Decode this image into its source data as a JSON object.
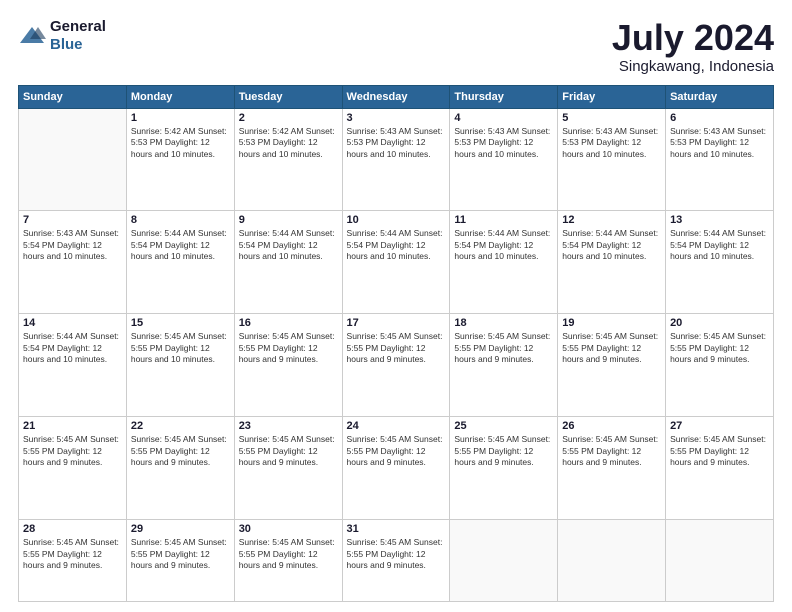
{
  "header": {
    "logo_general": "General",
    "logo_blue": "Blue",
    "title": "July 2024",
    "location": "Singkawang, Indonesia"
  },
  "days_of_week": [
    "Sunday",
    "Monday",
    "Tuesday",
    "Wednesday",
    "Thursday",
    "Friday",
    "Saturday"
  ],
  "weeks": [
    [
      {
        "num": "",
        "info": ""
      },
      {
        "num": "1",
        "info": "Sunrise: 5:42 AM\nSunset: 5:53 PM\nDaylight: 12 hours\nand 10 minutes."
      },
      {
        "num": "2",
        "info": "Sunrise: 5:42 AM\nSunset: 5:53 PM\nDaylight: 12 hours\nand 10 minutes."
      },
      {
        "num": "3",
        "info": "Sunrise: 5:43 AM\nSunset: 5:53 PM\nDaylight: 12 hours\nand 10 minutes."
      },
      {
        "num": "4",
        "info": "Sunrise: 5:43 AM\nSunset: 5:53 PM\nDaylight: 12 hours\nand 10 minutes."
      },
      {
        "num": "5",
        "info": "Sunrise: 5:43 AM\nSunset: 5:53 PM\nDaylight: 12 hours\nand 10 minutes."
      },
      {
        "num": "6",
        "info": "Sunrise: 5:43 AM\nSunset: 5:53 PM\nDaylight: 12 hours\nand 10 minutes."
      }
    ],
    [
      {
        "num": "7",
        "info": "Sunrise: 5:43 AM\nSunset: 5:54 PM\nDaylight: 12 hours\nand 10 minutes."
      },
      {
        "num": "8",
        "info": "Sunrise: 5:44 AM\nSunset: 5:54 PM\nDaylight: 12 hours\nand 10 minutes."
      },
      {
        "num": "9",
        "info": "Sunrise: 5:44 AM\nSunset: 5:54 PM\nDaylight: 12 hours\nand 10 minutes."
      },
      {
        "num": "10",
        "info": "Sunrise: 5:44 AM\nSunset: 5:54 PM\nDaylight: 12 hours\nand 10 minutes."
      },
      {
        "num": "11",
        "info": "Sunrise: 5:44 AM\nSunset: 5:54 PM\nDaylight: 12 hours\nand 10 minutes."
      },
      {
        "num": "12",
        "info": "Sunrise: 5:44 AM\nSunset: 5:54 PM\nDaylight: 12 hours\nand 10 minutes."
      },
      {
        "num": "13",
        "info": "Sunrise: 5:44 AM\nSunset: 5:54 PM\nDaylight: 12 hours\nand 10 minutes."
      }
    ],
    [
      {
        "num": "14",
        "info": "Sunrise: 5:44 AM\nSunset: 5:54 PM\nDaylight: 12 hours\nand 10 minutes."
      },
      {
        "num": "15",
        "info": "Sunrise: 5:45 AM\nSunset: 5:55 PM\nDaylight: 12 hours\nand 10 minutes."
      },
      {
        "num": "16",
        "info": "Sunrise: 5:45 AM\nSunset: 5:55 PM\nDaylight: 12 hours\nand 9 minutes."
      },
      {
        "num": "17",
        "info": "Sunrise: 5:45 AM\nSunset: 5:55 PM\nDaylight: 12 hours\nand 9 minutes."
      },
      {
        "num": "18",
        "info": "Sunrise: 5:45 AM\nSunset: 5:55 PM\nDaylight: 12 hours\nand 9 minutes."
      },
      {
        "num": "19",
        "info": "Sunrise: 5:45 AM\nSunset: 5:55 PM\nDaylight: 12 hours\nand 9 minutes."
      },
      {
        "num": "20",
        "info": "Sunrise: 5:45 AM\nSunset: 5:55 PM\nDaylight: 12 hours\nand 9 minutes."
      }
    ],
    [
      {
        "num": "21",
        "info": "Sunrise: 5:45 AM\nSunset: 5:55 PM\nDaylight: 12 hours\nand 9 minutes."
      },
      {
        "num": "22",
        "info": "Sunrise: 5:45 AM\nSunset: 5:55 PM\nDaylight: 12 hours\nand 9 minutes."
      },
      {
        "num": "23",
        "info": "Sunrise: 5:45 AM\nSunset: 5:55 PM\nDaylight: 12 hours\nand 9 minutes."
      },
      {
        "num": "24",
        "info": "Sunrise: 5:45 AM\nSunset: 5:55 PM\nDaylight: 12 hours\nand 9 minutes."
      },
      {
        "num": "25",
        "info": "Sunrise: 5:45 AM\nSunset: 5:55 PM\nDaylight: 12 hours\nand 9 minutes."
      },
      {
        "num": "26",
        "info": "Sunrise: 5:45 AM\nSunset: 5:55 PM\nDaylight: 12 hours\nand 9 minutes."
      },
      {
        "num": "27",
        "info": "Sunrise: 5:45 AM\nSunset: 5:55 PM\nDaylight: 12 hours\nand 9 minutes."
      }
    ],
    [
      {
        "num": "28",
        "info": "Sunrise: 5:45 AM\nSunset: 5:55 PM\nDaylight: 12 hours\nand 9 minutes."
      },
      {
        "num": "29",
        "info": "Sunrise: 5:45 AM\nSunset: 5:55 PM\nDaylight: 12 hours\nand 9 minutes."
      },
      {
        "num": "30",
        "info": "Sunrise: 5:45 AM\nSunset: 5:55 PM\nDaylight: 12 hours\nand 9 minutes."
      },
      {
        "num": "31",
        "info": "Sunrise: 5:45 AM\nSunset: 5:55 PM\nDaylight: 12 hours\nand 9 minutes."
      },
      {
        "num": "",
        "info": ""
      },
      {
        "num": "",
        "info": ""
      },
      {
        "num": "",
        "info": ""
      }
    ]
  ]
}
